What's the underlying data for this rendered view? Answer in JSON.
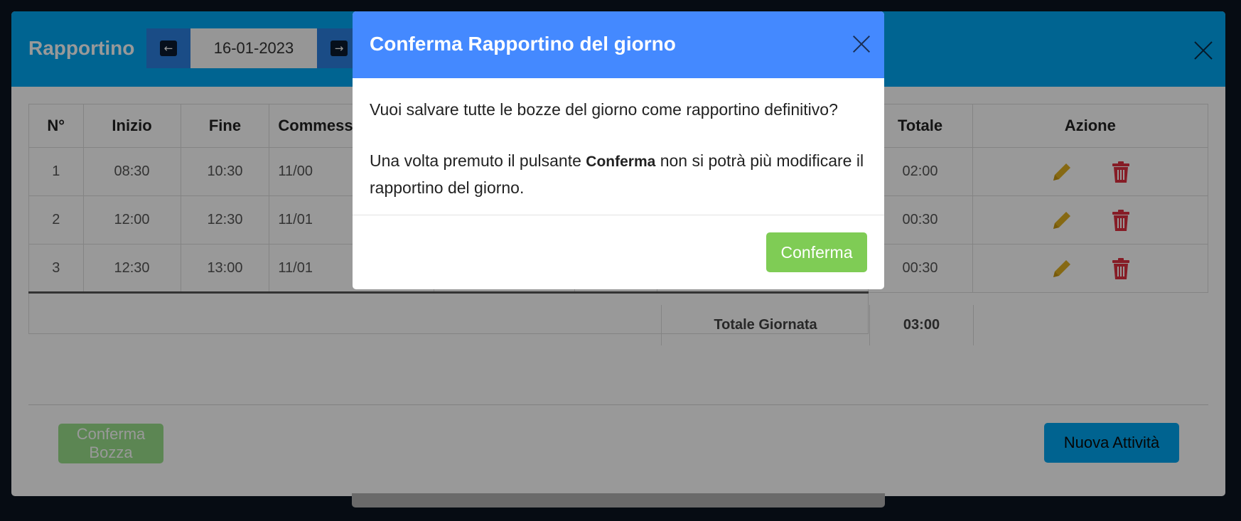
{
  "background_modal": {
    "title": "Rapportino",
    "date_value": "16-01-2023",
    "prev_icon": "arrow-left-icon",
    "next_icon": "arrow-right-icon",
    "close_icon": "close-icon",
    "table": {
      "headers": [
        "N°",
        "Inizio",
        "Fine",
        "Commess",
        "Totale",
        "Azione"
      ],
      "rows": [
        {
          "n": "1",
          "inizio": "08:30",
          "fine": "10:30",
          "commessa": "11/00",
          "totale": "02:00"
        },
        {
          "n": "2",
          "inizio": "12:00",
          "fine": "12:30",
          "commessa": "11/01",
          "totale": "00:30"
        },
        {
          "n": "3",
          "inizio": "12:30",
          "fine": "13:00",
          "commessa": "11/01",
          "totale": "00:30"
        }
      ],
      "total_label": "Totale Giornata",
      "total_value": "03:00"
    },
    "footer": {
      "conferma_bozza_label": "Conferma Bozza",
      "nuova_attivita_label": "Nuova Attività"
    },
    "colors": {
      "header": "#00a7f2",
      "edit": "#e0b020",
      "delete": "#e03040"
    }
  },
  "dialog": {
    "title": "Conferma Rapportino del giorno",
    "body_line1": "Vuoi salvare tutte le bozze del giorno come rapportino definitivo?",
    "body_line2_pre": "Una volta premuto il pulsante",
    "body_line2_bold": "Conferma",
    "body_line2_post": "non si potrà più modificare il rapportino del giorno.",
    "confirm_label": "Conferma",
    "close_icon": "close-icon",
    "colors": {
      "header": "#4489ff",
      "confirm": "#7fcc55"
    }
  }
}
